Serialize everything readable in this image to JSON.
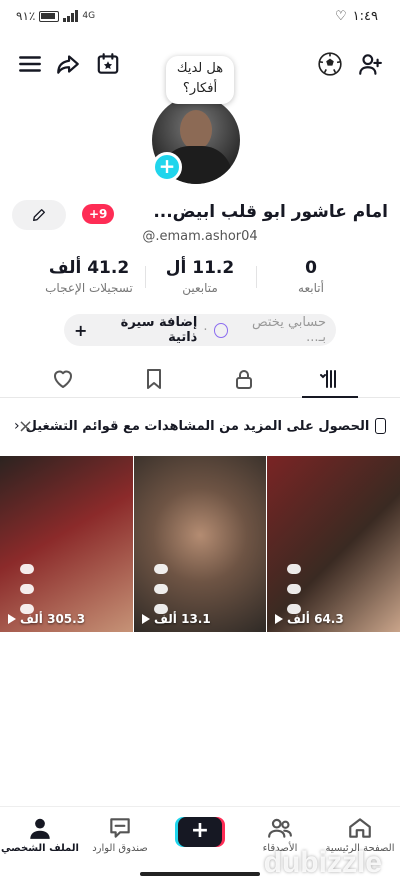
{
  "status_bar": {
    "battery": "٩١٪",
    "network": "4G",
    "time": "١:٤٩"
  },
  "idea_bubble": {
    "line1": "هل لديك",
    "line2": "أفكار؟"
  },
  "profile": {
    "display_name": "امام عاشور ابو قلب ابيض...",
    "username": "@.emam.ashor04",
    "new_badge": "+9"
  },
  "stats": [
    {
      "value": "0",
      "label": "أتابعه"
    },
    {
      "value": "11.2 أل",
      "label": "متابعين"
    },
    {
      "value": "41.2 ألف",
      "label": "تسجيلات الإعجاب"
    }
  ],
  "bio": {
    "add_label": "إضافة سيرة ذاتية",
    "placeholder": "حسابي يختص بـ..."
  },
  "banner": {
    "text": "الحصول على المزيد من المشاهدات مع قوائم التشغيل",
    "chevron": "‹",
    "close": "×"
  },
  "videos": [
    {
      "views": "64.3 ألف",
      "color_a": "#7a2424",
      "color_b": "#3a2a22"
    },
    {
      "views": "13.1 ألف",
      "color_a": "#6e5444",
      "color_b": "#2f2a26"
    },
    {
      "views": "305.3 ألف",
      "color_a": "#8b2a2a",
      "color_b": "#2b2320"
    }
  ],
  "nav": {
    "home": "الصفحة الرئيسية",
    "friends": "الأصدقاء",
    "create": "+",
    "inbox": "صندوق الوارد",
    "profile": "الملف الشخصي"
  },
  "watermark": "dubizzle",
  "colors": {
    "accent_red": "#fe2c55",
    "accent_cyan": "#20d5ec",
    "text": "#161823"
  }
}
